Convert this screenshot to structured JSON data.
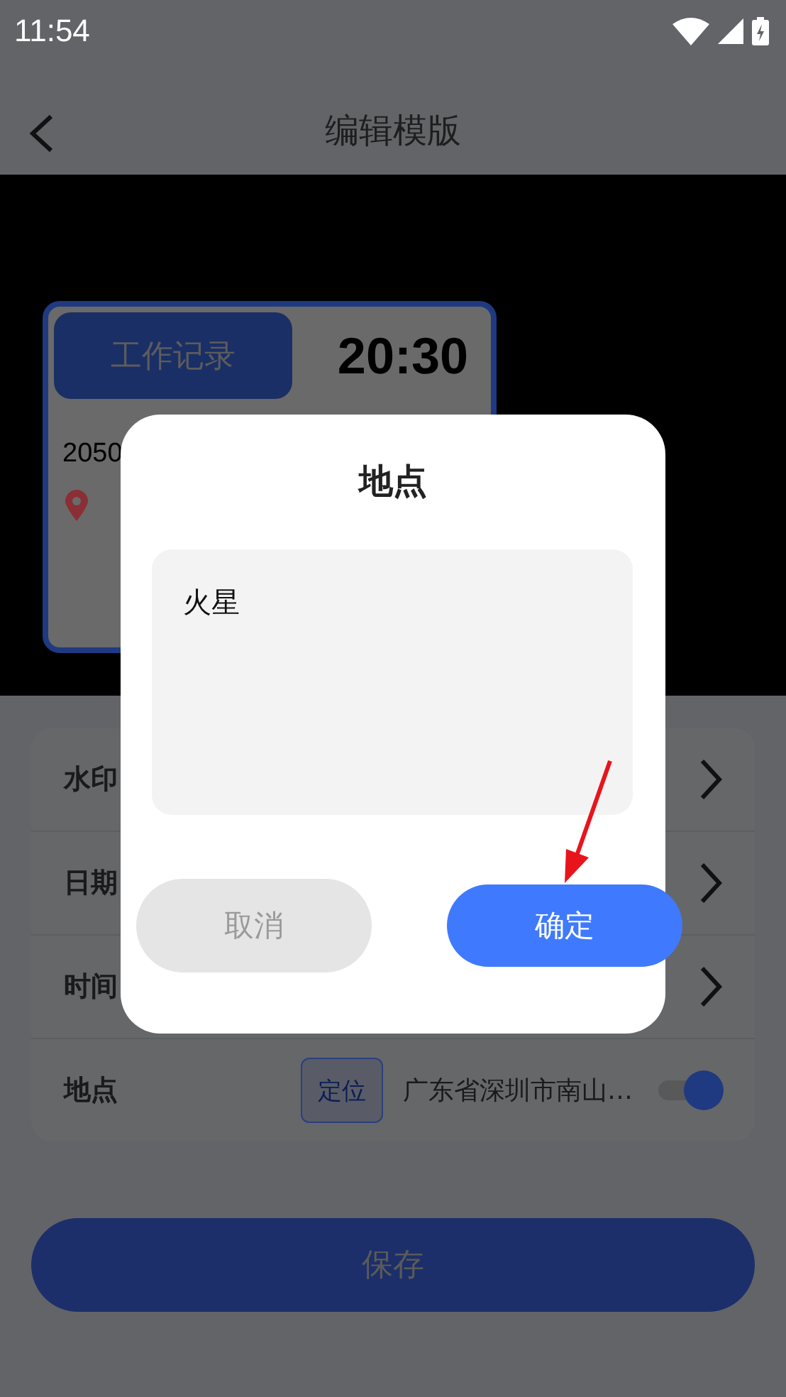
{
  "status_bar": {
    "time": "11:54"
  },
  "header": {
    "title": "编辑模版"
  },
  "preview_card": {
    "tag": "工作记录",
    "time": "20:30",
    "date": "2050"
  },
  "settings": [
    {
      "kind": "link",
      "label": "水印"
    },
    {
      "kind": "link",
      "label": "日期"
    },
    {
      "kind": "link",
      "label": "时间"
    },
    {
      "kind": "location",
      "label": "地点",
      "locate_button": "定位",
      "address": "广东省深圳市南山…",
      "on": true
    }
  ],
  "save_button": "保存",
  "dialog": {
    "title": "地点",
    "input": {
      "value": "火星"
    },
    "buttons": [
      {
        "kind": "cancel",
        "label": "取消"
      },
      {
        "kind": "confirm",
        "label": "确定"
      }
    ]
  }
}
